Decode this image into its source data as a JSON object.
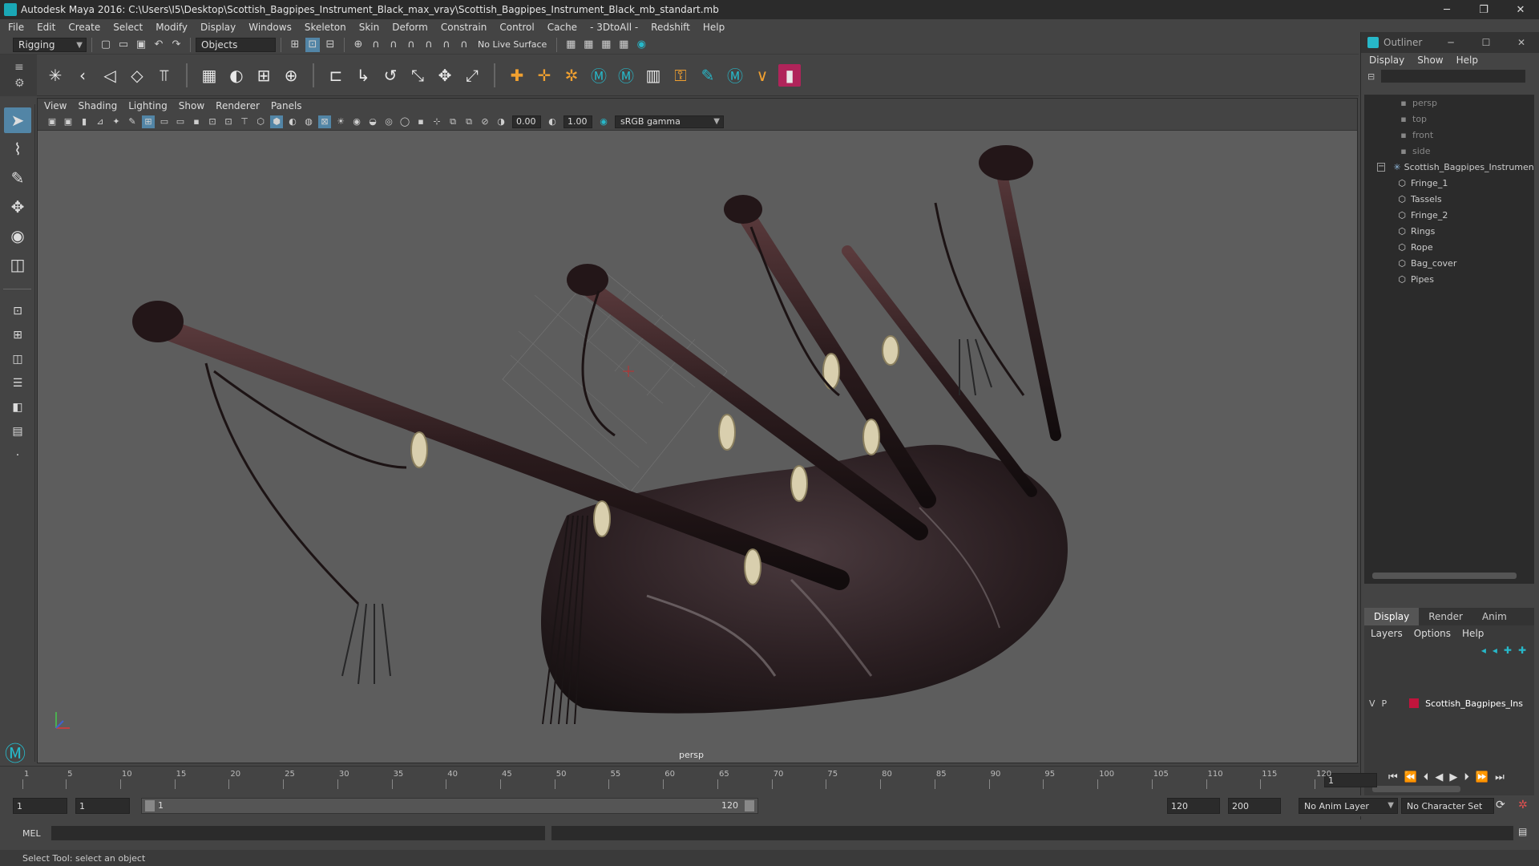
{
  "window": {
    "title": "Autodesk Maya 2016: C:\\Users\\I5\\Desktop\\Scottish_Bagpipes_Instrument_Black_max_vray\\Scottish_Bagpipes_Instrument_Black_mb_standart.mb",
    "minimize": "─",
    "restore": "❐",
    "close": "✕"
  },
  "menubar": [
    "File",
    "Edit",
    "Create",
    "Select",
    "Modify",
    "Display",
    "Windows",
    "Skeleton",
    "Skin",
    "Deform",
    "Constrain",
    "Control",
    "Cache",
    "- 3DtoAll -",
    "Redshift",
    "Help"
  ],
  "status": {
    "mode": "Rigging",
    "selection_mask": "Objects",
    "live_surface": "No Live Surface"
  },
  "panel": {
    "menu": [
      "View",
      "Shading",
      "Lighting",
      "Show",
      "Renderer",
      "Panels"
    ],
    "exposure": "0.00",
    "gamma": "1.00",
    "color_space": "sRGB gamma",
    "camera": "persp"
  },
  "outliner": {
    "title": "Outliner",
    "menu": [
      "Display",
      "Show",
      "Help"
    ],
    "cameras": [
      "persp",
      "top",
      "front",
      "side"
    ],
    "root": "Scottish_Bagpipes_Instrument_Black",
    "children": [
      "Fringe_1",
      "Tassels",
      "Fringe_2",
      "Rings",
      "Rope",
      "Bag_cover",
      "Pipes"
    ]
  },
  "layers": {
    "tabs": [
      "Display",
      "Render",
      "Anim"
    ],
    "menu": [
      "Layers",
      "Options",
      "Help"
    ],
    "row": {
      "v": "V",
      "p": "P",
      "name": "Scottish_Bagpipes_Ins",
      "color": "#c0143c"
    }
  },
  "timeline": {
    "ticks": [
      "1",
      "5",
      "10",
      "15",
      "20",
      "25",
      "30",
      "35",
      "40",
      "45",
      "50",
      "55",
      "60",
      "65",
      "70",
      "75",
      "80",
      "85",
      "90",
      "95",
      "100",
      "105",
      "110",
      "115",
      "120"
    ],
    "current_frame": "1"
  },
  "range": {
    "start": "1",
    "playback_start": "1",
    "bar_start": "1",
    "bar_end": "120",
    "playback_end": "120",
    "end": "200",
    "anim_layer": "No Anim Layer",
    "character_set": "No Character Set"
  },
  "command": {
    "lang": "MEL"
  },
  "help": {
    "text": "Select Tool: select an object"
  },
  "colors": {
    "accent": "#5285a6",
    "maya_teal": "#27b8c9",
    "layer": "#c0143c"
  }
}
